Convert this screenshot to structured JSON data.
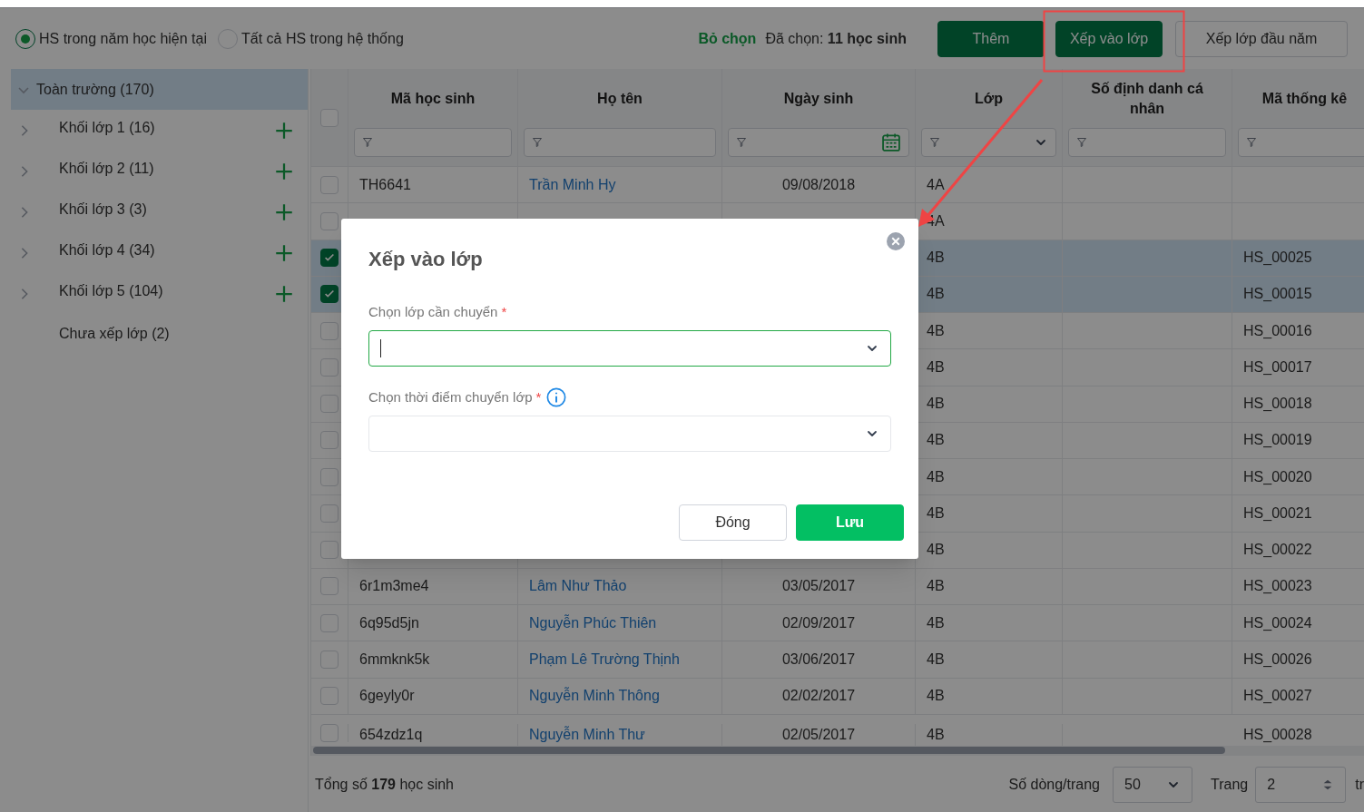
{
  "scope_options": [
    {
      "label": "HS trong năm học hiện tại",
      "selected": true
    },
    {
      "label": "Tất cả HS trong hệ thống",
      "selected": false
    }
  ],
  "selection": {
    "clear_link": "Bỏ chọn",
    "label": "Đã chọn:",
    "count": "11 học sinh"
  },
  "toolbar_buttons": [
    {
      "label": "Thêm",
      "kind": "primary",
      "highlighted": false
    },
    {
      "label": "Xếp vào lớp",
      "kind": "primary",
      "highlighted": true
    },
    {
      "label": "Xếp lớp đầu năm",
      "kind": "outline",
      "highlighted": false
    }
  ],
  "tree": {
    "label": "Toàn trường (170)",
    "expanded": true,
    "selected": true,
    "children": [
      {
        "label": "Khối lớp 1 (16)",
        "expandable": true,
        "addable": true
      },
      {
        "label": "Khối lớp 2 (11)",
        "expandable": true,
        "addable": true
      },
      {
        "label": "Khối lớp 3 (3)",
        "expandable": true,
        "addable": true
      },
      {
        "label": "Khối lớp 4 (34)",
        "expandable": true,
        "addable": true
      },
      {
        "label": "Khối lớp 5 (104)",
        "expandable": true,
        "addable": true
      },
      {
        "label": "Chưa xếp lớp (2)",
        "expandable": false,
        "addable": false
      }
    ]
  },
  "table": {
    "header_checked": false,
    "columns": [
      {
        "title": "Mã học sinh",
        "kind": "text"
      },
      {
        "title": "Họ tên",
        "kind": "text"
      },
      {
        "title": "Ngày sinh",
        "kind": "date"
      },
      {
        "title": "Lớp",
        "kind": "select"
      },
      {
        "title": "Số định danh cá nhân",
        "kind": "text"
      },
      {
        "title": "Mã thống kê",
        "kind": "text"
      }
    ],
    "rows": [
      {
        "checked": false,
        "ma": "TH6641",
        "ho_ten": "Trần Minh Hy",
        "ngay_sinh": "09/08/2018",
        "lop": "4A"
      },
      {
        "checked": false,
        "lop": "4A"
      },
      {
        "checked": true,
        "lop": "4B",
        "ma_thong_ke": "HS_00025"
      },
      {
        "checked": true,
        "lop": "4B",
        "ma_thong_ke": "HS_00015"
      },
      {
        "checked": false,
        "lop": "4B",
        "ma_thong_ke": "HS_00016"
      },
      {
        "checked": false,
        "lop": "4B",
        "ma_thong_ke": "HS_00017"
      },
      {
        "checked": false,
        "lop": "4B",
        "ma_thong_ke": "HS_00018"
      },
      {
        "checked": false,
        "lop": "4B",
        "ma_thong_ke": "HS_00019"
      },
      {
        "checked": false,
        "lop": "4B",
        "ma_thong_ke": "HS_00020"
      },
      {
        "checked": false,
        "lop": "4B",
        "ma_thong_ke": "HS_00021"
      },
      {
        "checked": false,
        "lop": "4B",
        "ma_thong_ke": "HS_00022"
      },
      {
        "checked": false,
        "ma": "6r1m3me4",
        "ho_ten": "Lâm Như Thảo",
        "ngay_sinh": "03/05/2017",
        "lop": "4B",
        "ma_thong_ke": "HS_00023"
      },
      {
        "checked": false,
        "ma": "6q95d5jn",
        "ho_ten": "Nguyễn Phúc Thiên",
        "ngay_sinh": "02/09/2017",
        "lop": "4B",
        "ma_thong_ke": "HS_00024"
      },
      {
        "checked": false,
        "ma": "6mmknk5k",
        "ho_ten": "Phạm Lê Trường Thịnh",
        "ngay_sinh": "03/06/2017",
        "lop": "4B",
        "ma_thong_ke": "HS_00026"
      },
      {
        "checked": false,
        "ma": "6geyly0r",
        "ho_ten": "Nguyễn Minh Thông",
        "ngay_sinh": "02/02/2017",
        "lop": "4B",
        "ma_thong_ke": "HS_00027"
      },
      {
        "checked": false,
        "ma": "654zdz1q",
        "ho_ten": "Nguyễn Minh Thư",
        "ngay_sinh": "02/05/2017",
        "lop": "4B",
        "ma_thong_ke": "HS_00028"
      }
    ]
  },
  "footer": {
    "total": "Tổng số **179** học sinh",
    "page_size_label": "Số dòng/trang",
    "page_size": "50",
    "page_label": "Trang",
    "page": "2",
    "trailing": "tr"
  },
  "dialog": {
    "title": "Xếp vào lớp",
    "fields": [
      {
        "label": "Chọn lớp cần chuyển",
        "required_mark": "*",
        "info": false,
        "focused": true
      },
      {
        "label": "Chọn thời điểm chuyển lớp",
        "required_mark": "*",
        "info": true,
        "focused": false
      }
    ],
    "buttons": [
      {
        "label": "Đóng",
        "kind": "secondary"
      },
      {
        "label": "Lưu",
        "kind": "primary"
      }
    ]
  }
}
